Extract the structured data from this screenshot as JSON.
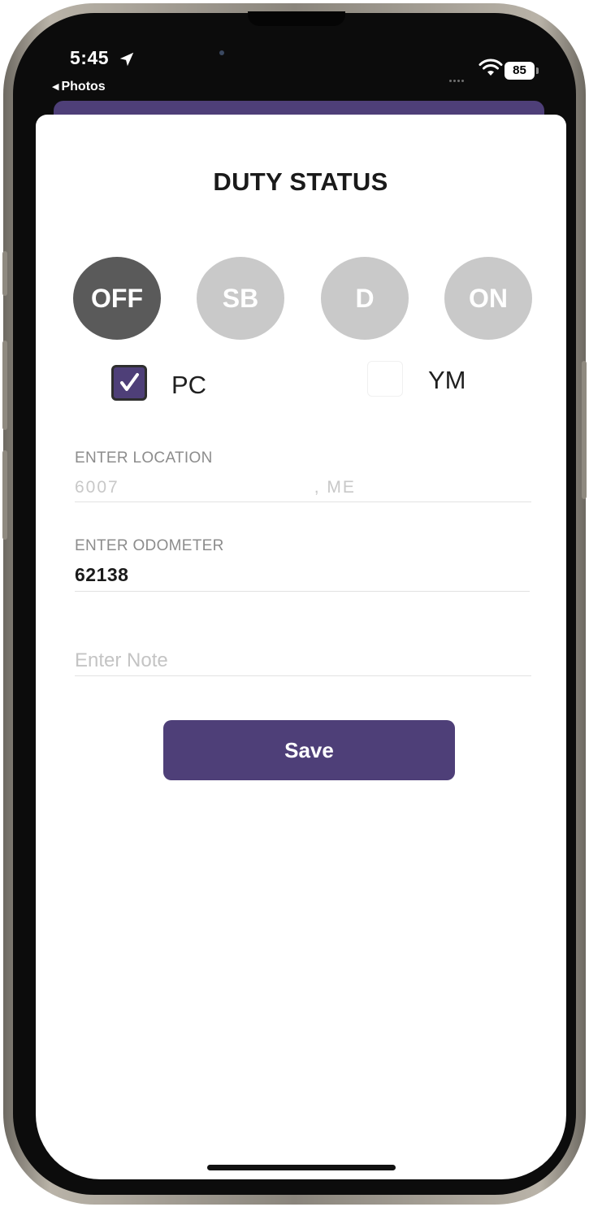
{
  "status_bar": {
    "time": "5:45",
    "back_app": "Photos",
    "battery": "85"
  },
  "sheet": {
    "title": "DUTY STATUS",
    "status_buttons": [
      {
        "label": "OFF",
        "state": "active"
      },
      {
        "label": "SB",
        "state": "inactive"
      },
      {
        "label": "D",
        "state": "inactive"
      },
      {
        "label": "ON",
        "state": "inactive"
      }
    ],
    "checkboxes": [
      {
        "label": "PC",
        "checked": true
      },
      {
        "label": "YM",
        "checked": false
      }
    ],
    "location": {
      "label": "ENTER LOCATION",
      "value_visible_start": "6007",
      "value_visible_end": ", ME"
    },
    "odometer": {
      "label": "ENTER ODOMETER",
      "value": "62138"
    },
    "note": {
      "placeholder": "Enter Note",
      "value": ""
    },
    "save_label": "Save"
  },
  "colors": {
    "accent": "#4e3f78",
    "active_status": "#5a5a5a",
    "inactive_status": "#c9c9c9"
  },
  "icons": [
    "location-arrow-icon",
    "wifi-icon",
    "battery-icon",
    "checkmark-icon"
  ]
}
